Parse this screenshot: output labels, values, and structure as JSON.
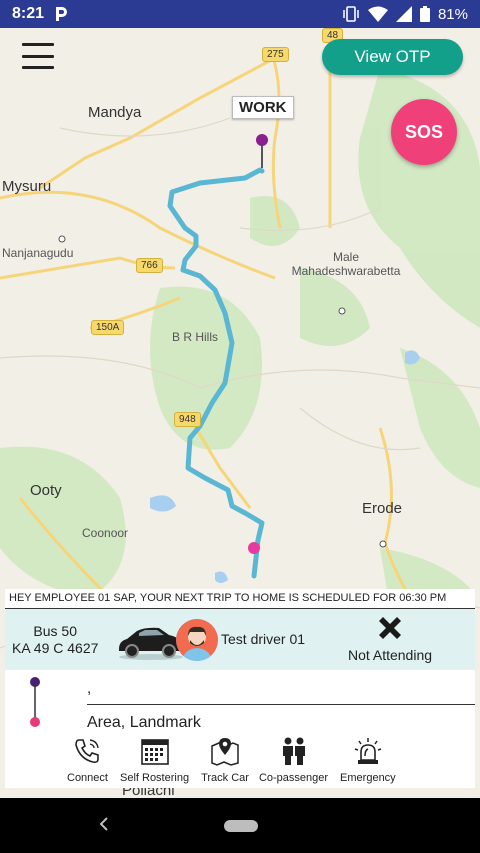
{
  "status_bar": {
    "time": "8:21",
    "battery": "81%"
  },
  "map": {
    "labels": [
      "Mandya",
      "Mysuru",
      "Nanjanagudu",
      "Male Mahadeshwarabetta",
      "B R Hills",
      "Ooty",
      "Coonoor",
      "Erode",
      "Pollachi"
    ],
    "shields": [
      "275",
      "48",
      "766",
      "150A",
      "948"
    ],
    "work_label": "WORK"
  },
  "buttons": {
    "view_otp": "View OTP",
    "sos": "SOS"
  },
  "trip": {
    "banner": "HEY EMPLOYEE 01 SAP, YOUR NEXT TRIP TO HOME IS SCHEDULED FOR 06:30 PM",
    "bus_name": "Bus 50",
    "bus_plate": "KA 49 C 4627",
    "driver": "Test driver 01",
    "not_attending": "Not Attending"
  },
  "address": {
    "from": ",",
    "to": "Area, Landmark"
  },
  "bottom_nav": {
    "items": [
      {
        "label": "Connect",
        "icon": "phone-icon"
      },
      {
        "label": "Self Rostering",
        "icon": "calendar-icon"
      },
      {
        "label": "Track Car",
        "icon": "map-pin-icon"
      },
      {
        "label": "Co-passenger",
        "icon": "people-icon"
      },
      {
        "label": "Emergency",
        "icon": "siren-icon"
      }
    ]
  },
  "colors": {
    "status_bar": "#2b3a92",
    "accent": "#13a08a",
    "sos": "#f0407a",
    "route": "#5ab7d4"
  }
}
